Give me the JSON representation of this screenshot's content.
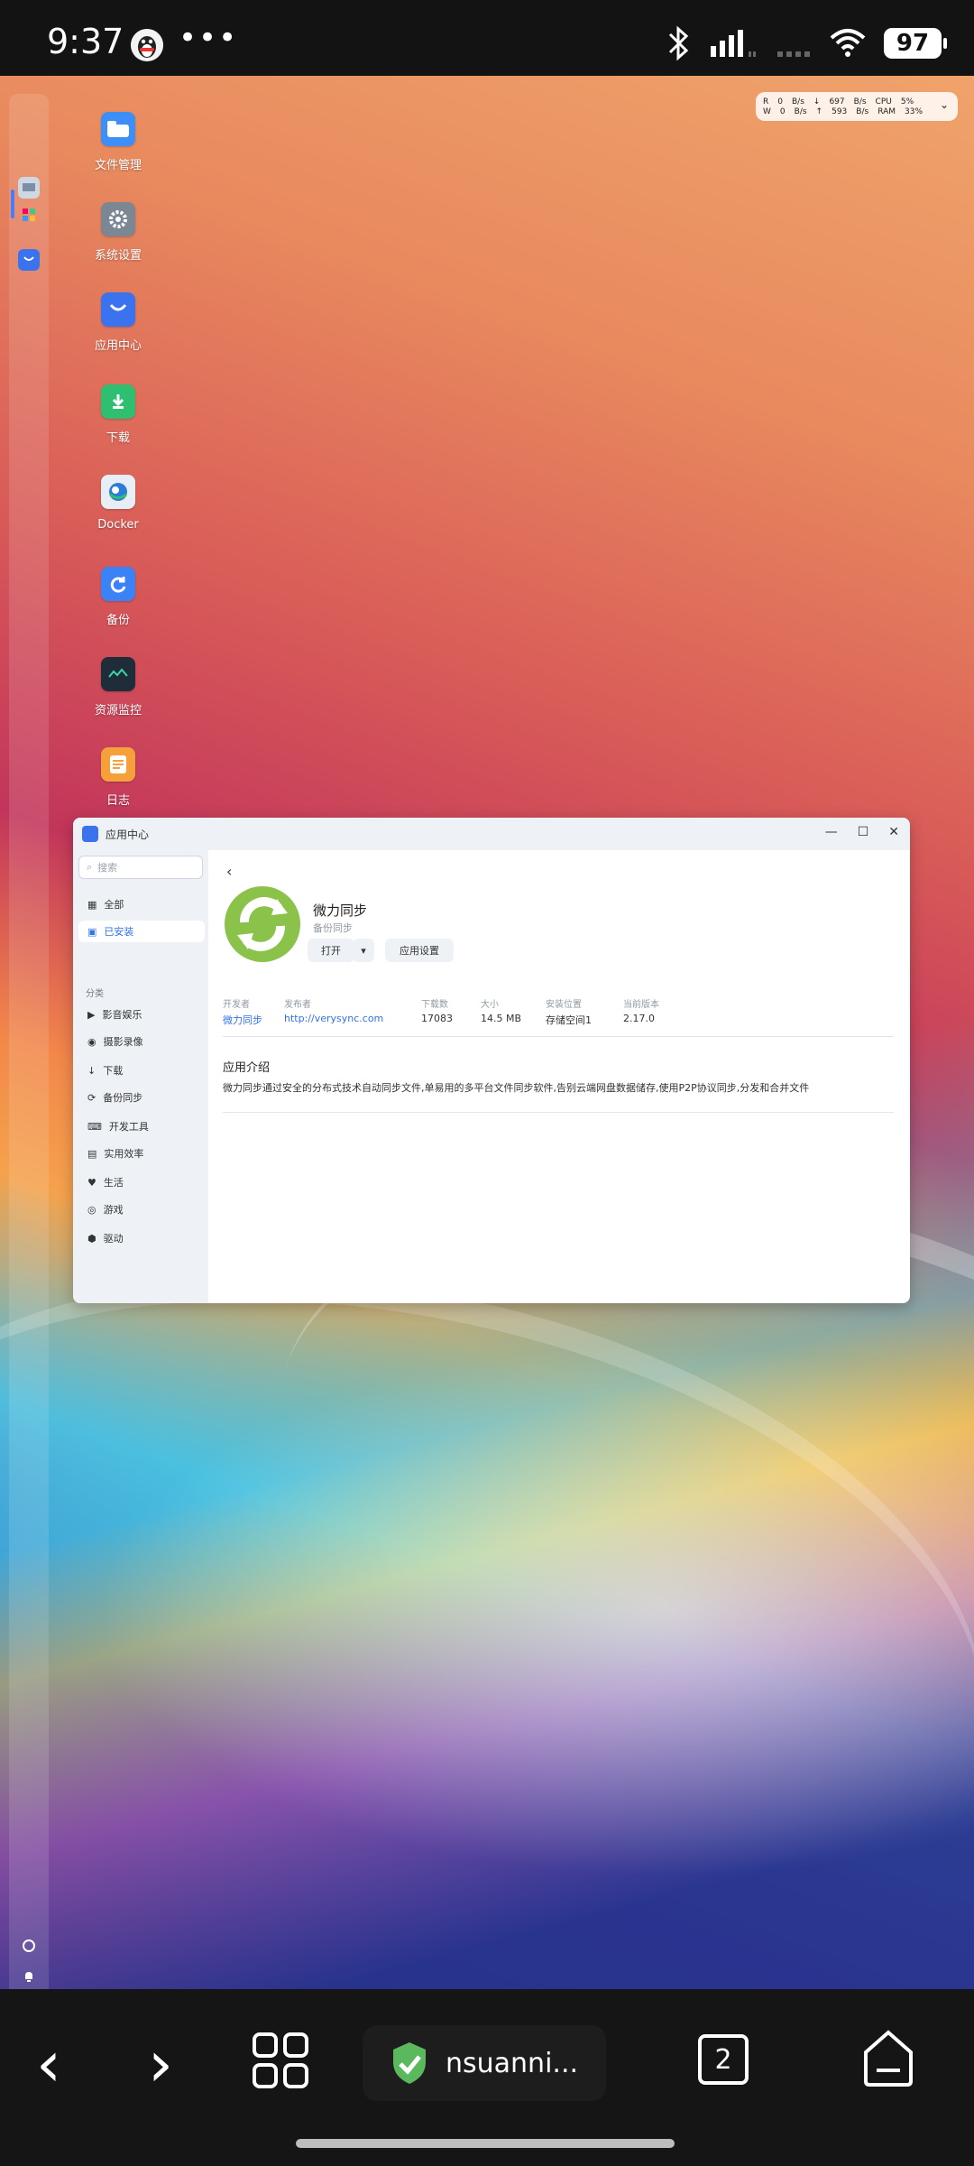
{
  "status_bar": {
    "time": "9:37",
    "more": "•••",
    "battery": "97"
  },
  "net_monitor": {
    "down_label": "R",
    "up_label": "W",
    "net_rx": "0",
    "net_tx": "0",
    "unit": "B/s",
    "rx_arrow": "↓",
    "tx_arrow": "↑",
    "speed1": "697",
    "speed2": "593",
    "cpu_label": "CPU",
    "cpu_val": "5%",
    "ram_label": "RAM",
    "ram_val": "33%"
  },
  "desktop_icons": [
    {
      "label": "文件管理",
      "icon": "folder-icon",
      "color": "#3e8ef7"
    },
    {
      "label": "系统设置",
      "icon": "gear-icon",
      "color": "#7c8794"
    },
    {
      "label": "应用中心",
      "icon": "store-icon",
      "color": "#3b73ee"
    },
    {
      "label": "下载",
      "icon": "download-icon",
      "color": "#2fbf71"
    },
    {
      "label": "Docker",
      "icon": "docker-icon",
      "color": "#e7eef6"
    },
    {
      "label": "备份",
      "icon": "backup-icon",
      "color": "#3b82f6"
    },
    {
      "label": "资源监控",
      "icon": "monitor-icon",
      "color": "#1f2d3a"
    },
    {
      "label": "日志",
      "icon": "log-icon",
      "color": "#f6a03b"
    }
  ],
  "app_window": {
    "title": "应用中心",
    "search_placeholder": "搜索",
    "nav": {
      "all": "全部",
      "installed": "已安装",
      "section": "分类",
      "categories": [
        "影音娱乐",
        "摄影录像",
        "下载",
        "备份同步",
        "开发工具",
        "实用效率",
        "生活",
        "游戏",
        "驱动"
      ]
    },
    "app": {
      "name": "微力同步",
      "category": "备份同步",
      "open_button": "打开",
      "open_dropdown": "▾",
      "settings_button": "应用设置",
      "meta_labels": [
        "开发者",
        "发布者",
        "下载数",
        "大小",
        "安装位置",
        "当前版本"
      ],
      "meta_values": [
        "微力同步",
        "http://verysync.com",
        "17083",
        "14.5 MB",
        "存储空间1",
        "2.17.0"
      ],
      "intro_title": "应用介绍",
      "intro_text": "微力同步通过安全的分布式技术自动同步文件,单易用的多平台文件同步软件,告别云端网盘数据储存,使用P2P协议同步,分发和合并文件"
    }
  },
  "bottom_nav": {
    "back": "‹",
    "forward": "›",
    "task_label": "nsuanni...",
    "tabs": "2"
  }
}
